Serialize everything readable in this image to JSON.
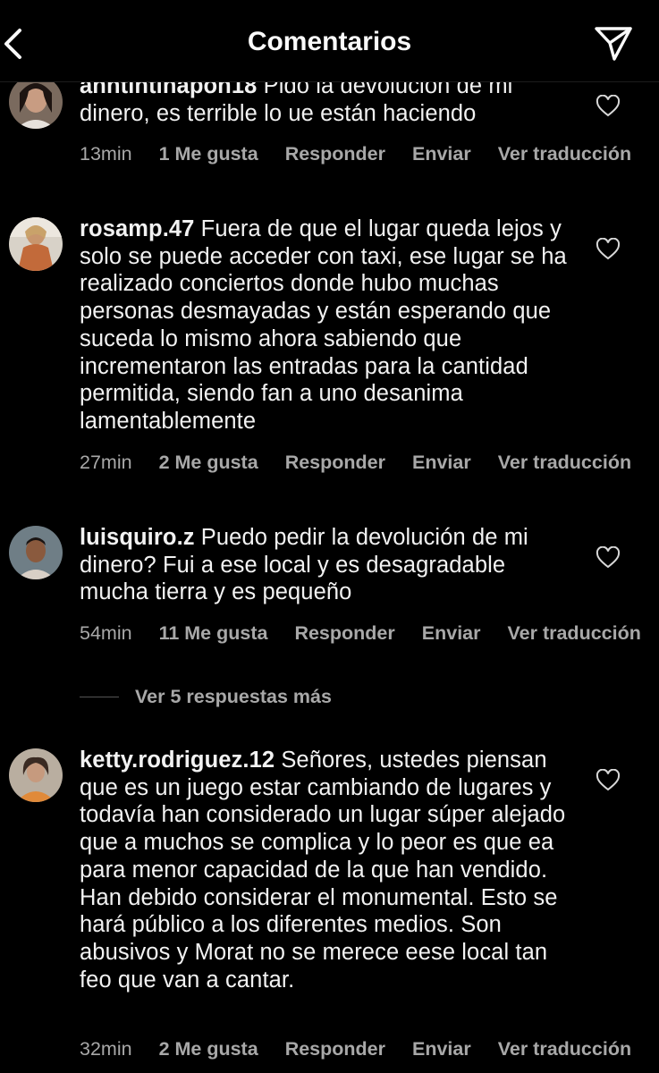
{
  "header": {
    "title": "Comentarios",
    "back_icon": "chevron-left-icon",
    "send_icon": "paper-plane-icon"
  },
  "comments": [
    {
      "username": "anntintinapon18",
      "text": "Pido la devolución de mi dinero, es terrible lo ue están haciendo",
      "time": "13min",
      "likes": "1 Me gusta",
      "reply": "Responder",
      "send": "Enviar",
      "translate": "Ver traducción"
    },
    {
      "username": "rosamp.47",
      "text": "Fuera de que el lugar queda lejos y solo se puede acceder con taxi, ese lugar se ha realizado conciertos donde hubo muchas personas desmayadas y están esperando que suceda lo mismo ahora sabiendo que incrementaron las entradas para la cantidad permitida, siendo fan a uno desanima lamentablemente",
      "time": "27min",
      "likes": "2 Me gusta",
      "reply": "Responder",
      "send": "Enviar",
      "translate": "Ver traducción"
    },
    {
      "username": "luisquiro.z",
      "text": "Puedo pedir la devolución de mi dinero? Fui a ese local y es desagradable mucha tierra y es pequeño",
      "time": "54min",
      "likes": "11 Me gusta",
      "reply": "Responder",
      "send": "Enviar",
      "translate": "Ver traducción"
    },
    {
      "username": "ketty.rodriguez.12",
      "text": "Señores, ustedes piensan que es un juego estar cambiando de lugares y todavía han considerado un lugar súper alejado que a muchos se complica y lo peor es que ea para menor capacidad de la que han vendido. Han debido considerar el monumental. Esto se hará público a los diferentes medios. Son abusivos y Morat no se merece eese local tan feo que van a cantar.",
      "time": "32min",
      "likes": "2 Me gusta",
      "reply": "Responder",
      "send": "Enviar",
      "translate": "Ver traducción"
    }
  ],
  "view_replies": "Ver 5 respuestas más",
  "colors": {
    "background": "#000000",
    "text": "#f2f2f2",
    "secondary": "#a8a8a8"
  }
}
